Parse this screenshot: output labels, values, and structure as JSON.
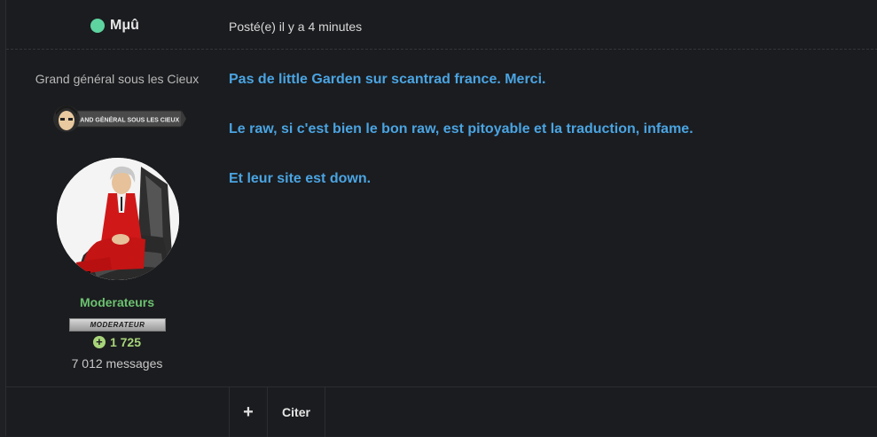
{
  "post": {
    "author": {
      "name": "Mμû",
      "online_color": "#5ed4a0"
    },
    "date": "Posté(e) il y a 4 minutes",
    "user": {
      "title": "Grand général sous les Cieux",
      "rank_image_text": "GRAND GÉNÉRAL SOUS LES CIEUX",
      "group": "Moderateurs",
      "badge_text": "MODERATEUR",
      "reputation_icon": "plus-circle-icon",
      "reputation": "1 725",
      "post_count": "7 012 messages"
    },
    "content": {
      "paragraphs": [
        "Pas de little Garden sur scantrad france. Merci.",
        "Le raw, si c'est bien le bon raw, est pitoyable et la traduction, infame.",
        "Et leur site est down."
      ]
    },
    "actions": {
      "plus_label": "+",
      "quote_label": "Citer"
    }
  },
  "colors": {
    "accent_text": "#4aa4e2",
    "group_color": "#6cc270",
    "reputation_color": "#a8d47a",
    "background": "#1b1c1f"
  }
}
